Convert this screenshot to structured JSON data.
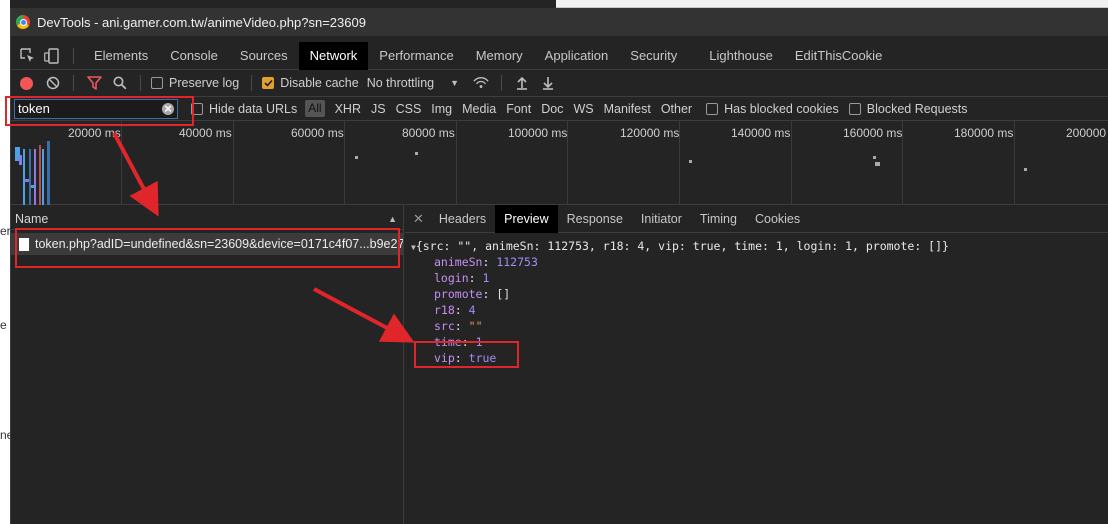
{
  "window_title": "DevTools - ani.gamer.com.tw/animeVideo.php?sn=23609",
  "panel_tabs": [
    "Elements",
    "Console",
    "Sources",
    "Network",
    "Performance",
    "Memory",
    "Application",
    "Security",
    "Lighthouse",
    "EditThisCookie"
  ],
  "active_panel": "Network",
  "toolbar": {
    "preserve_log": "Preserve log",
    "disable_cache": "Disable cache",
    "throttling": "No throttling"
  },
  "filter": {
    "value": "token",
    "hide_data_urls": "Hide data URLs",
    "all": "All",
    "types": [
      "XHR",
      "JS",
      "CSS",
      "Img",
      "Media",
      "Font",
      "Doc",
      "WS",
      "Manifest",
      "Other"
    ],
    "has_blocked_cookies": "Has blocked cookies",
    "blocked_requests": "Blocked Requests"
  },
  "timeline_ticks": [
    "20000 ms",
    "40000 ms",
    "60000 ms",
    "80000 ms",
    "100000 ms",
    "120000 ms",
    "140000 ms",
    "160000 ms",
    "180000 ms",
    "200000"
  ],
  "requests": {
    "column_name": "Name",
    "rows": [
      "token.php?adID=undefined&sn=23609&device=0171c4f07...b9e27..."
    ]
  },
  "detail_tabs": [
    "Headers",
    "Preview",
    "Response",
    "Initiator",
    "Timing",
    "Cookies"
  ],
  "active_detail_tab": "Preview",
  "preview": {
    "summary": "{src: \"\", animeSn: 112753, r18: 4, vip: true, time: 1, login: 1, promote: []}",
    "props": [
      {
        "key": "animeSn",
        "value": "112753",
        "kind": "num"
      },
      {
        "key": "login",
        "value": "1",
        "kind": "num"
      },
      {
        "key": "promote",
        "value": "[]",
        "kind": "plain"
      },
      {
        "key": "r18",
        "value": "4",
        "kind": "num"
      },
      {
        "key": "src",
        "value": "\"\"",
        "kind": "str"
      },
      {
        "key": "time",
        "value": "1",
        "kind": "num"
      },
      {
        "key": "vip",
        "value": "true",
        "kind": "kw"
      }
    ]
  },
  "colors": {
    "record": "#f25757",
    "annotation": "#e0262b",
    "checkbox_on": "#e2a02f",
    "key": "#c390f2",
    "number": "#a28cf6"
  },
  "background_page_fragments": [
    "er",
    "e",
    "ne"
  ]
}
